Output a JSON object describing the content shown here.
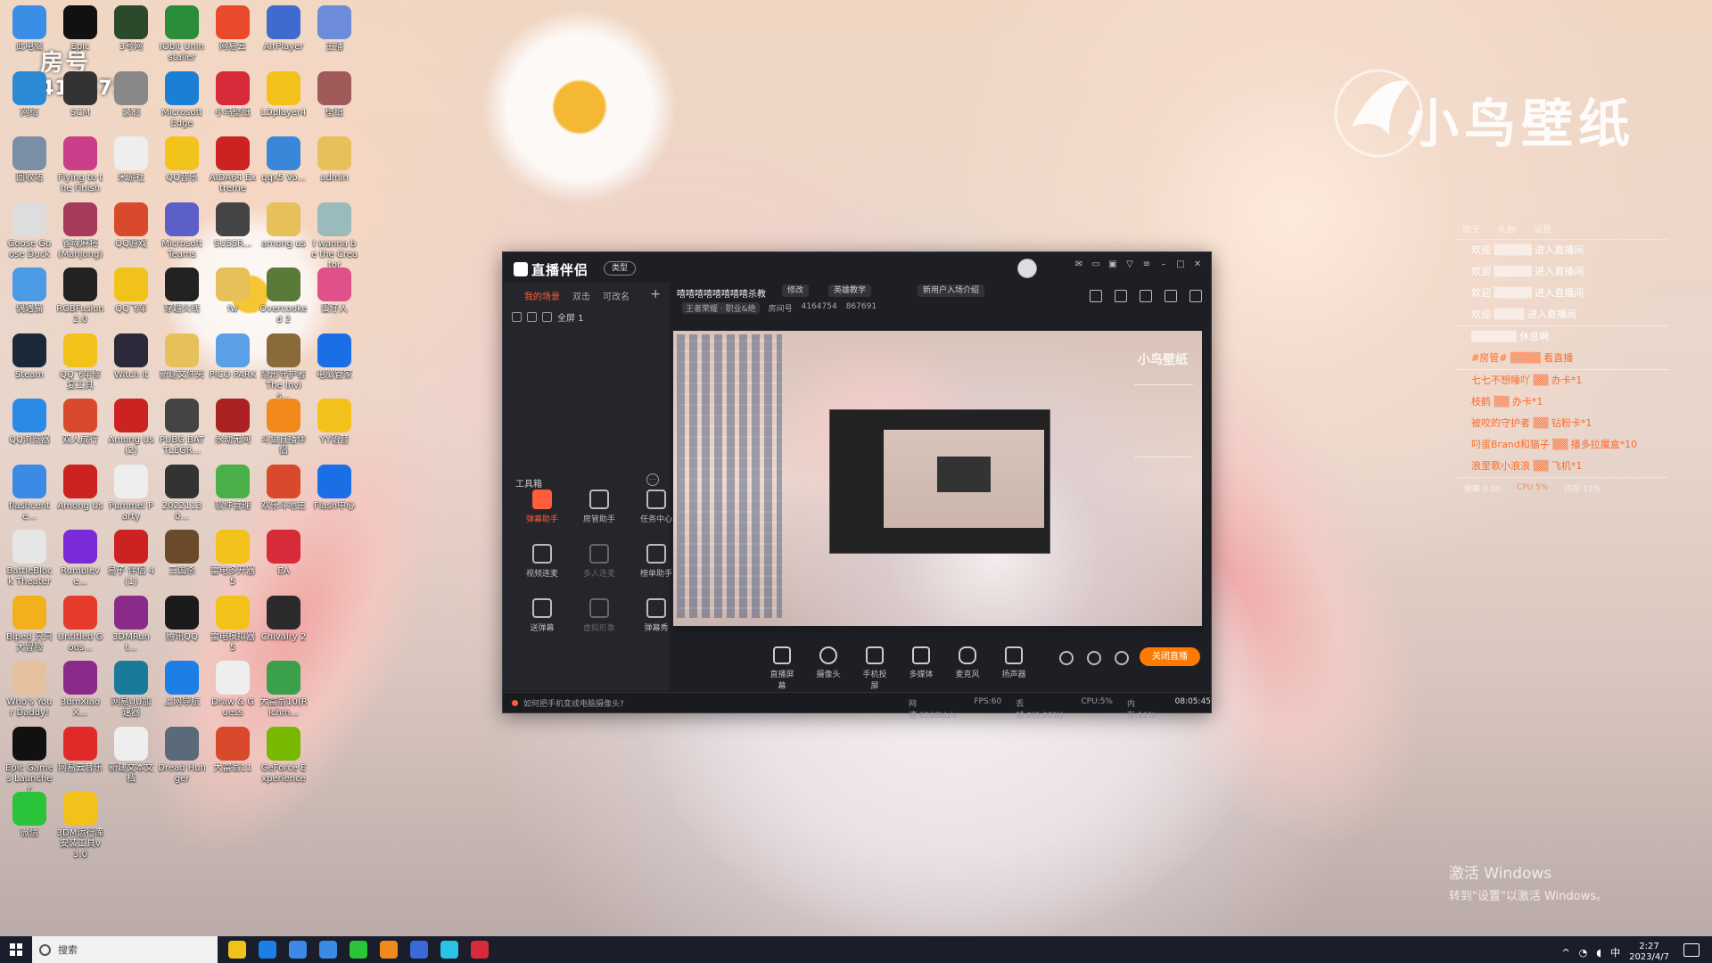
{
  "desktop": {
    "watermark": "小鸟壁纸",
    "room_overlay": {
      "label": "房号",
      "number": "4164754"
    },
    "icons": [
      [
        "此电脑",
        "#3a8ee6"
      ],
      [
        "Epic",
        "#111"
      ],
      [
        "3号网",
        "#2b4a2b"
      ],
      [
        "IObit Uninstaller",
        "#2b8c3a"
      ],
      [
        "网易云",
        "#e84a2b"
      ],
      [
        "AirPlayer",
        "#3f6bd1"
      ],
      [
        "主播",
        "#6c8bd8"
      ],
      [
        "网络",
        "#2a8ad6"
      ],
      [
        "SCM",
        "#333"
      ],
      [
        "录制",
        "#888"
      ],
      [
        "Microsoft Edge",
        "#1b7fd6"
      ],
      [
        "小鸟壁纸",
        "#d82b3a"
      ],
      [
        "LDplayer4",
        "#f2c21b"
      ],
      [
        "壁纸",
        "#a05a5a"
      ],
      [
        "回收站",
        "#7a8fa5"
      ],
      [
        "Flying to the Finish",
        "#ca3e8a"
      ],
      [
        "米游社",
        "#eee"
      ],
      [
        "QQ音乐",
        "#f2c31b"
      ],
      [
        "AIDA64 Extreme",
        "#c22"
      ],
      [
        "qqx5 Vo...",
        "#3a87d9"
      ],
      [
        "admin",
        "#e6c15a"
      ],
      [
        "Goose Goose Duck",
        "#ddd"
      ],
      [
        "雀魂麻将 (Mahjong)",
        "#a63a5a"
      ],
      [
        "QQ游戏",
        "#d84a2b"
      ],
      [
        "Microsoft Teams",
        "#5b5fc7"
      ],
      [
        "SUSSR...",
        "#444"
      ],
      [
        "among us",
        "#e6c15a"
      ],
      [
        "I wanna be the Creator",
        "#9bb"
      ],
      [
        "偶遇猫",
        "#4a9ae6"
      ],
      [
        "RGBFusion 2.0",
        "#222"
      ],
      [
        "QQ飞车",
        "#f2c21b"
      ],
      [
        "穿越火线",
        "#222"
      ],
      [
        "fw",
        "#e6c15a"
      ],
      [
        "Overcooked 2",
        "#5a7a3a"
      ],
      [
        "蛋仔人",
        "#e0508a"
      ],
      [
        "Steam",
        "#1b2838"
      ],
      [
        "QQ飞车修复工具",
        "#f2c21b"
      ],
      [
        "Witch It",
        "#2a2a3a"
      ],
      [
        "新建文件夹",
        "#e6c15a"
      ],
      [
        "PICO PARK",
        "#5aa0e6"
      ],
      [
        "隐形守护者 The Invis...",
        "#8a6a3a"
      ],
      [
        "电脑管家",
        "#1b6fe6"
      ],
      [
        "QQ浏览器",
        "#2a8ae6"
      ],
      [
        "双人成行",
        "#d84a2b"
      ],
      [
        "Among Us (2)",
        "#c22"
      ],
      [
        "PUBG BATTLEGR...",
        "#444"
      ],
      [
        "永劫无间",
        "#a22"
      ],
      [
        "斗鱼直播伴侣",
        "#f28a1b"
      ],
      [
        "YY语音",
        "#f2c21b"
      ],
      [
        "flashcente...",
        "#3a8ae6"
      ],
      [
        "Among Us",
        "#c22"
      ],
      [
        "Pummel Party",
        "#eee"
      ],
      [
        "20221130...",
        "#333"
      ],
      [
        "软件管理",
        "#4ab04a"
      ],
      [
        "欢乐斗地主",
        "#d84a2b"
      ],
      [
        "Flash中心",
        "#1b6fe6"
      ],
      [
        "BattleBlock Theater",
        "#e6e6e6"
      ],
      [
        "Rumbleve...",
        "#7a2ad8"
      ],
      [
        "易子 伴侣 4 (1)",
        "#c22"
      ],
      [
        "三国杀",
        "#6a4a2a"
      ],
      [
        "雷电多开器5",
        "#f2c21b"
      ],
      [
        "EA",
        "#d82b3a"
      ],
      [
        "Biped 只只 大冒险",
        "#f2b01b"
      ],
      [
        "Untitled Goos...",
        "#e63a2a"
      ],
      [
        "3DMRunt...",
        "#8a2a8a"
      ],
      [
        "腾讯QQ",
        "#1b1b1b"
      ],
      [
        "雷电模拟器5",
        "#f2c21b"
      ],
      [
        "Chivalry 2",
        "#2a2a2a"
      ],
      [
        "Who's Your Daddy!",
        "#e6c1a0"
      ],
      [
        "3dmXiaoX...",
        "#8a2a8a"
      ],
      [
        "网易UU加速器",
        "#1b7a9a"
      ],
      [
        "上网导航",
        "#1b7fe6"
      ],
      [
        "Draw & Guess",
        "#eee"
      ],
      [
        "大富翁10(Richm...",
        "#3aa04a"
      ],
      [
        "Epic Games Launcher",
        "#111"
      ],
      [
        "网易云音乐",
        "#e02a2a"
      ],
      [
        "新建文本文档",
        "#eee"
      ],
      [
        "Dread Hunger",
        "#5a6a7a"
      ],
      [
        "大富翁11",
        "#d84a2b"
      ],
      [
        "GeForce Experience",
        "#76b900"
      ],
      [
        "微信",
        "#2ac33a"
      ],
      [
        "3DM运行库安装工具v3.0",
        "#f2c21b"
      ]
    ]
  },
  "chat_panel": {
    "header": [
      "聊天",
      "礼物",
      "设置"
    ],
    "lines": [
      "欢迎 ▒▒▒▒▒ 进入直播间",
      "欢迎 ▒▒▒▒▒ 进入直播间",
      "欢迎 ▒▒▒▒▒ 进入直播间",
      "欢迎 ▒▒▒▒ 进入直播间",
      "▒▒▒▒▒▒ 休息啊",
      "#房管# ▒▒▒▒ 看直播"
    ],
    "gifts": [
      "七七不想睡吖 ▒▒ 办卡*1",
      "枝鹤 ▒▒ 办卡*1",
      "被咬的守护者 ▒▒ 钻粉卡*1",
      "叼蛋Brand和猫子 ▒▒ 播多拉魔盒*10",
      "浪里歌小浪浪 ▒▒ 飞机*1"
    ],
    "footer": [
      "弹幕 0.00",
      "CPU 5%",
      "内存 11%"
    ]
  },
  "app": {
    "title": "直播伴侣",
    "mode": "类型",
    "scene_tabs": [
      "我的场景",
      "双击",
      "可改名"
    ],
    "source": "全屏 1",
    "tools_title": "工具箱",
    "tools": [
      {
        "label": "弹幕助手",
        "state": "on"
      },
      {
        "label": "房管助手",
        "state": ""
      },
      {
        "label": "任务中心",
        "state": ""
      },
      {
        "label": "视频连麦",
        "state": ""
      },
      {
        "label": "多人连麦",
        "state": "dim"
      },
      {
        "label": "榜单助手",
        "state": ""
      },
      {
        "label": "送弹幕",
        "state": ""
      },
      {
        "label": "虚拟形象",
        "state": "dim"
      },
      {
        "label": "弹幕秀",
        "state": ""
      }
    ],
    "room": {
      "title": "嘻嘻嘻嘻嘻嘻嘻嘻杀教",
      "edit": "修改",
      "chip1": "英雄教学",
      "chip2": "新用户入场介绍",
      "category": "王者荣耀 · 职业&绝",
      "room_label": "房间号",
      "room_id": "4164754",
      "heat": "867691"
    },
    "bottom_tools": [
      "直播屏幕",
      "摄像头",
      "手机投屏",
      "多媒体",
      "麦克风",
      "扬声器"
    ],
    "live_button": "关闭直播",
    "status_tip": "如何把手机变成电脑摄像头?",
    "stats": [
      "网速:6268kb/s",
      "FPS:60",
      "丢帧:0(0.00%)",
      "CPU:5%",
      "内存:11%"
    ],
    "timer": "08:05:45"
  },
  "activate": {
    "title": "激活 Windows",
    "sub": "转到\"设置\"以激活 Windows。"
  },
  "taskbar": {
    "search_placeholder": "搜索",
    "time": "2:27",
    "date": "2023/4/7",
    "ime": "中",
    "app_colors": [
      "#f2c21b",
      "#1b7fe6",
      "#3a8ae6",
      "#3a8ae6",
      "#2ac33a",
      "#f28a1b",
      "#3a6ad8",
      "#2ac3e6",
      "#d82b3a"
    ]
  }
}
